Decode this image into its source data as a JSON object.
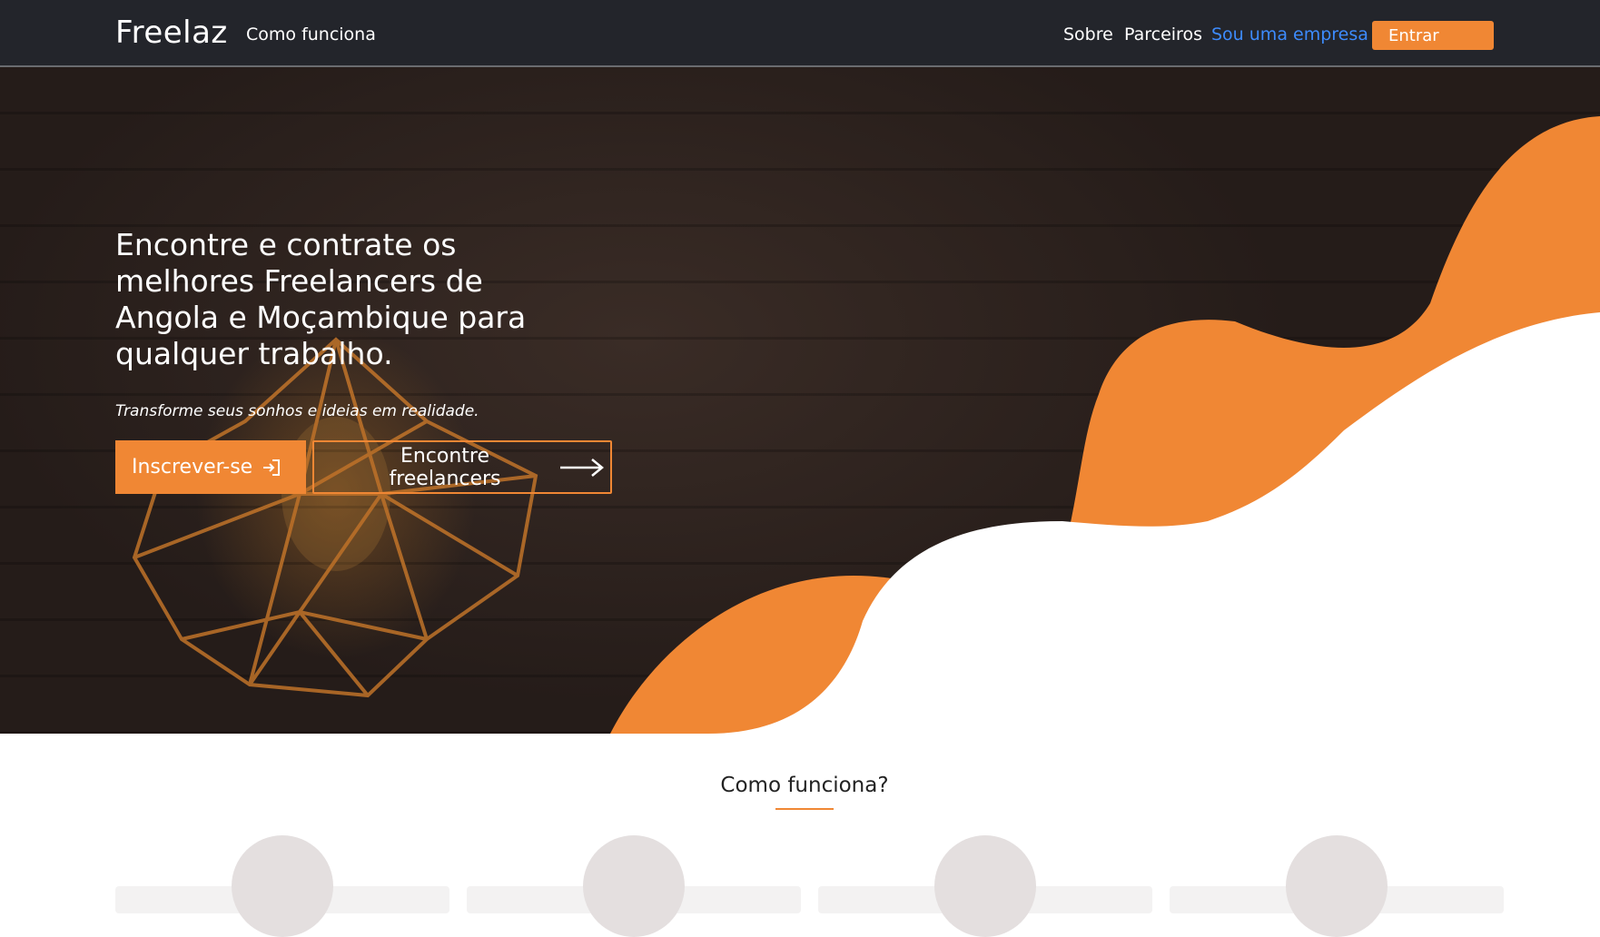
{
  "navbar": {
    "brand": "Freelaz",
    "how_it_works": "Como funciona",
    "about": "Sobre",
    "partners": "Parceiros",
    "company": "Sou uma empresa",
    "login": "Entrar"
  },
  "hero": {
    "headline": "Encontre e contrate os melhores Freelancers de Angola e Moçambique para qualquer trabalho.",
    "subheadline": "Transforme seus sonhos e ideias em realidade.",
    "signup_button": "Inscrever-se",
    "find_button": "Encontre freelancers",
    "signup_icon": "login-icon",
    "find_icon": "arrow-right-icon"
  },
  "how_section": {
    "title": "Como funciona?"
  },
  "colors": {
    "accent": "#f08734",
    "navbar": "#23252b",
    "link": "#3d8bfd"
  }
}
